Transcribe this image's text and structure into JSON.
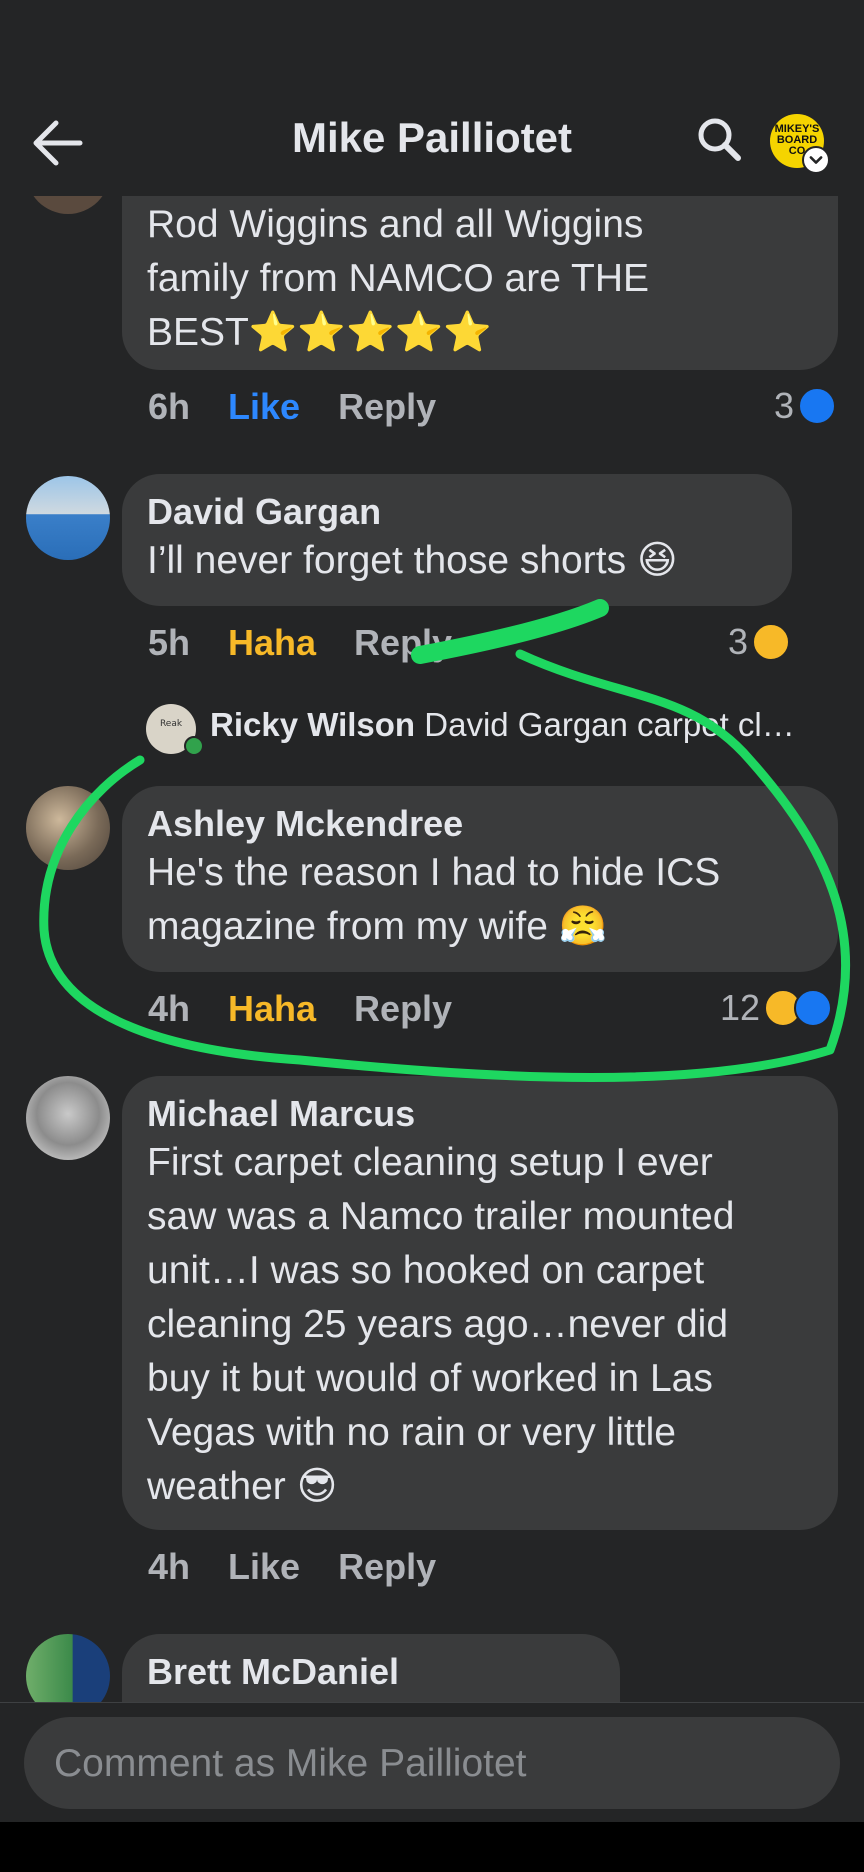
{
  "header": {
    "title": "Mike Pailliotet",
    "page_avatar_text": "MIKEY'S BOARD CO"
  },
  "comments": [
    {
      "name": "",
      "text_lines": [
        "Rod Wiggins and all Wiggins",
        "family from NAMCO are THE",
        "BEST⭐⭐⭐⭐⭐"
      ],
      "time": "6h",
      "react_label": "Like",
      "reply_label": "Reply",
      "reaction_count": "3"
    },
    {
      "name": "David Gargan",
      "text_lines": [
        "I’ll never forget those shorts 😆"
      ],
      "time": "5h",
      "react_label": "Haha",
      "reply_label": "Reply",
      "reaction_count": "3"
    },
    {
      "name": "Ashley Mckendree",
      "text_lines": [
        "He's the reason I had to hide ICS",
        "magazine from my wife 😤"
      ],
      "time": "4h",
      "react_label": "Haha",
      "reply_label": "Reply",
      "reaction_count": "12"
    },
    {
      "name": "Michael Marcus",
      "text_lines": [
        "First carpet cleaning setup I ever",
        "saw was a Namco trailer mounted",
        "unit…I was so hooked on carpet",
        "cleaning 25 years ago…never did",
        "buy it but would of worked in Las",
        "Vegas with no rain or very little",
        "weather 😎"
      ],
      "time": "4h",
      "react_label": "Like",
      "reply_label": "Reply"
    },
    {
      "name": "Brett McDaniel"
    }
  ],
  "reply_preview": {
    "name": "Ricky Wilson",
    "text": "David Gargan carpet cl…",
    "avatar_text": "Reak in the hed"
  },
  "composer": {
    "placeholder": "Comment as Mike Pailliotet"
  },
  "colors": {
    "background": "#242526",
    "bubble": "#3a3b3c",
    "like_blue": "#2d88ff",
    "haha_yellow": "#f7b928",
    "annotation_green": "#1ed760"
  },
  "icons": [
    "back-arrow-icon",
    "search-icon",
    "like-reaction-icon",
    "haha-reaction-icon",
    "chevron-down-icon",
    "online-dot-icon"
  ]
}
